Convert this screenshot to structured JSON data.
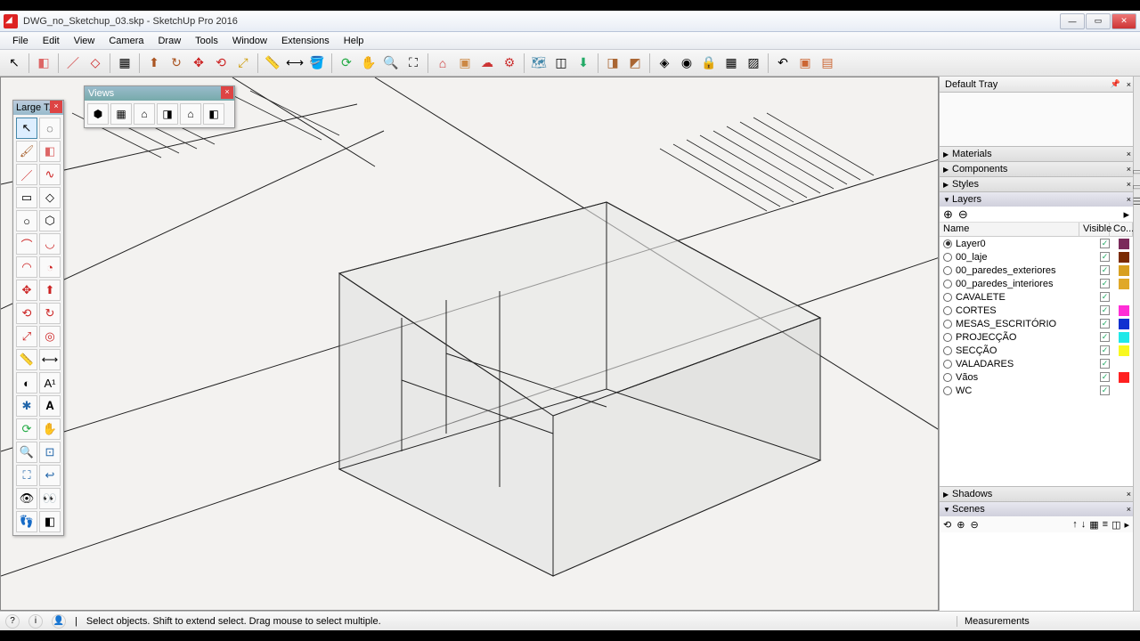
{
  "title": "DWG_no_Sketchup_03.skp - SketchUp Pro 2016",
  "menu": [
    "File",
    "Edit",
    "View",
    "Camera",
    "Draw",
    "Tools",
    "Window",
    "Extensions",
    "Help"
  ],
  "left_toolbar_title": "Large T...",
  "views_title": "Views",
  "tray_title": "Default Tray",
  "panels": {
    "materials": "Materials",
    "components": "Components",
    "styles": "Styles",
    "layers": "Layers",
    "shadows": "Shadows",
    "scenes": "Scenes"
  },
  "layers_head": {
    "name": "Name",
    "visible": "Visible",
    "color": "Co..."
  },
  "layers": [
    {
      "name": "Layer0",
      "active": true,
      "visible": true,
      "color": "#7a2a5a"
    },
    {
      "name": "00_laje",
      "active": false,
      "visible": true,
      "color": "#7a2a00"
    },
    {
      "name": "00_paredes_exteriores",
      "active": false,
      "visible": true,
      "color": "#d8a020"
    },
    {
      "name": "00_paredes_interiores",
      "active": false,
      "visible": true,
      "color": "#e0a828"
    },
    {
      "name": "CAVALETE",
      "active": false,
      "visible": true,
      "color": ""
    },
    {
      "name": "CORTES",
      "active": false,
      "visible": true,
      "color": "#ff2ed6"
    },
    {
      "name": "MESAS_ESCRITÓRIO",
      "active": false,
      "visible": true,
      "color": "#1030d0"
    },
    {
      "name": "PROJECÇÃO",
      "active": false,
      "visible": true,
      "color": "#20e8e8"
    },
    {
      "name": "SECÇÃO",
      "active": false,
      "visible": true,
      "color": "#f8f820"
    },
    {
      "name": "VALADARES",
      "active": false,
      "visible": true,
      "color": ""
    },
    {
      "name": "Vãos",
      "active": false,
      "visible": true,
      "color": "#ff2020"
    },
    {
      "name": "WC",
      "active": false,
      "visible": true,
      "color": ""
    }
  ],
  "status_text": "Select objects. Shift to extend select. Drag mouse to select multiple.",
  "measurements_label": "Measurements"
}
